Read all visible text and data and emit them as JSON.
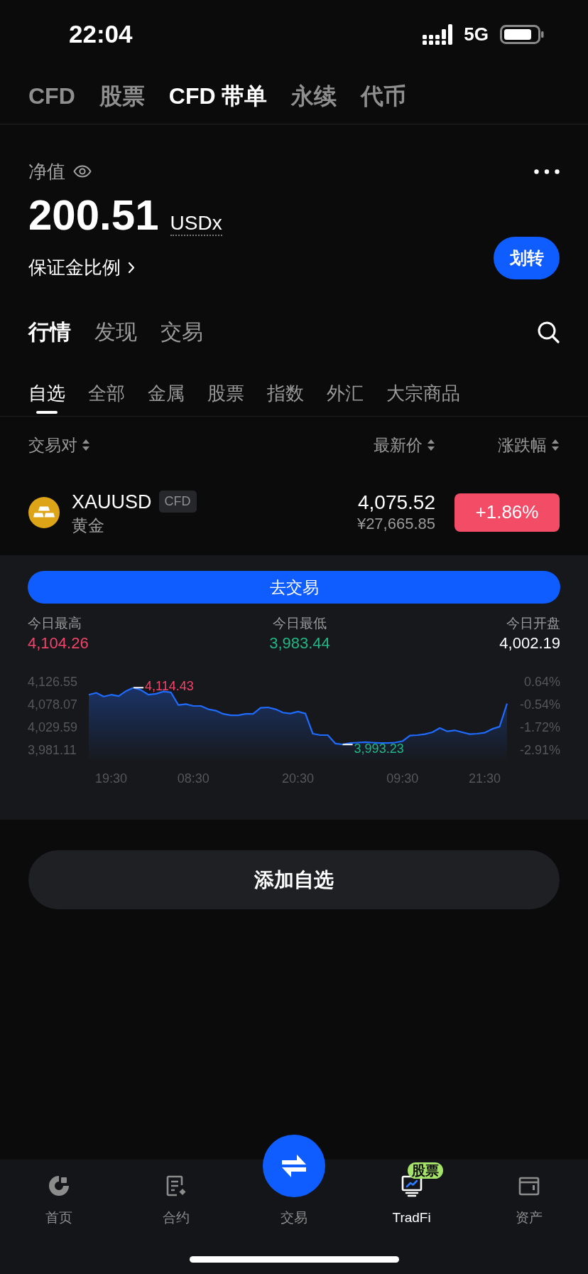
{
  "status_bar": {
    "time": "22:04",
    "network": "5G"
  },
  "top_tabs": [
    {
      "label": "CFD",
      "selected": false
    },
    {
      "label": "股票",
      "selected": false
    },
    {
      "label": "CFD 带单",
      "selected": true
    },
    {
      "label": "永续",
      "selected": false
    },
    {
      "label": "代币",
      "selected": false
    }
  ],
  "account": {
    "label": "净值",
    "value": "200.51",
    "currency": "USDx",
    "margin_ratio_link": "保证金比例",
    "transfer_button": "划转"
  },
  "section_tabs": [
    {
      "label": "行情",
      "selected": true
    },
    {
      "label": "发现",
      "selected": false
    },
    {
      "label": "交易",
      "selected": false
    }
  ],
  "filter_tabs": [
    {
      "label": "自选",
      "selected": true
    },
    {
      "label": "全部",
      "selected": false
    },
    {
      "label": "金属",
      "selected": false
    },
    {
      "label": "股票",
      "selected": false
    },
    {
      "label": "指数",
      "selected": false
    },
    {
      "label": "外汇",
      "selected": false
    },
    {
      "label": "大宗商品",
      "selected": false
    }
  ],
  "table": {
    "columns": [
      "交易对",
      "最新价",
      "涨跌幅"
    ],
    "rows": [
      {
        "symbol": "XAUUSD",
        "tag": "CFD",
        "name": "黄金",
        "price": "4,075.52",
        "price_cny": "¥27,665.85",
        "change": "+1.86%",
        "color": "#f24c67",
        "expanded": true,
        "detail": {
          "trade_button": "去交易",
          "stats": [
            {
              "label": "今日最高",
              "value": "4,104.26",
              "kind": "high"
            },
            {
              "label": "今日最低",
              "value": "3,983.44",
              "kind": "low"
            },
            {
              "label": "今日开盘",
              "value": "4,002.19",
              "kind": "open"
            }
          ],
          "chart_data": {
            "type": "area",
            "categories": [
              null,
              null,
              null,
              "19:30",
              null,
              null,
              null,
              null,
              null,
              null,
              null,
              null,
              null,
              null,
              "08:30",
              null,
              null,
              null,
              null,
              null,
              null,
              null,
              null,
              null,
              null,
              null,
              null,
              null,
              "20:30",
              null,
              null,
              null,
              null,
              null,
              null,
              null,
              null,
              null,
              null,
              null,
              null,
              null,
              "09:30",
              null,
              null,
              null,
              null,
              null,
              null,
              null,
              null,
              null,
              null,
              "21:30",
              null,
              null,
              null
            ],
            "series": [
              {
                "color": "#1f6bff",
                "values": [
                  4099,
                  4103,
                  4095,
                  4099,
                  4096,
                  4107,
                  4114,
                  4109,
                  4099,
                  4101,
                  4106,
                  4104,
                  4077,
                  4079,
                  4075,
                  4075,
                  4068,
                  4065,
                  4058,
                  4055,
                  4055,
                  4058,
                  4058,
                  4071,
                  4072,
                  4068,
                  4061,
                  4059,
                  4063,
                  4059,
                  4016,
                  4013,
                  4013,
                  3995,
                  3993,
                  3996,
                  3997,
                  3998,
                  3997,
                  3996,
                  3996,
                  3997,
                  4000,
                  4012,
                  4013,
                  4015,
                  4019,
                  4028,
                  4021,
                  4023,
                  4019,
                  4015,
                  4016,
                  4018,
                  4026,
                  4031,
                  4080
                ]
              }
            ],
            "ylim": [
              3981.11,
              4126.55
            ],
            "yticks": [
              {
                "value": 4126.55,
                "label": "4,126.55"
              },
              {
                "value": 4078.07,
                "label": "4,078.07"
              },
              {
                "value": 4029.59,
                "label": "4,029.59"
              },
              {
                "value": 3981.11,
                "label": "3,981.11"
              }
            ]
          },
          "right_axis_labels": [
            "0.64%",
            "-0.54%",
            "-1.72%",
            "-2.91%"
          ],
          "price_markers": [
            {
              "label": "4,114.43",
              "kind": "high"
            },
            {
              "label": "3,993.23",
              "kind": "low"
            }
          ]
        }
      }
    ]
  },
  "add_watchlist_button": "添加自选",
  "bottom_nav": [
    {
      "label": "首页",
      "selected": false,
      "kind": "tab"
    },
    {
      "label": "合约",
      "selected": false,
      "kind": "tab"
    },
    {
      "label": "交易",
      "selected": false,
      "kind": "center"
    },
    {
      "label": "TradFi",
      "selected": true,
      "kind": "tab",
      "badge": "股票"
    },
    {
      "label": "资产",
      "selected": false,
      "kind": "tab"
    }
  ]
}
